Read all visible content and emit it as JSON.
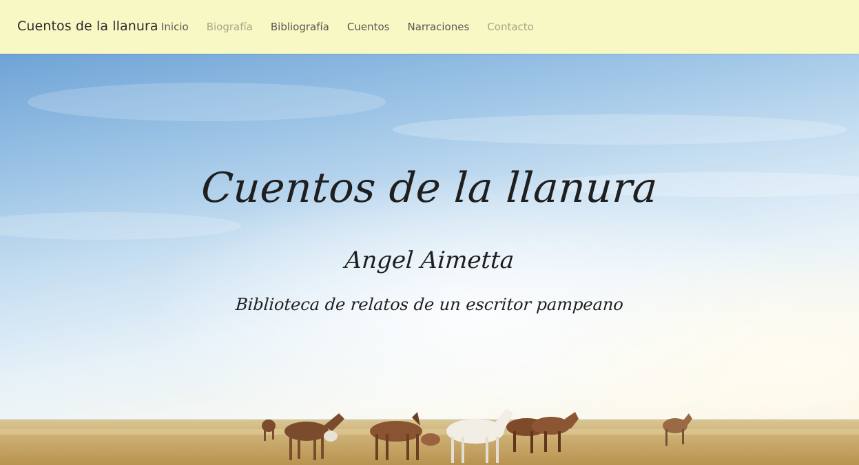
{
  "navbar": {
    "brand": "Cuentos de la llanura",
    "items": [
      {
        "label": "Inicio",
        "state": "normal"
      },
      {
        "label": "Biografía",
        "state": "muted"
      },
      {
        "label": "Bibliografía",
        "state": "normal"
      },
      {
        "label": "Cuentos",
        "state": "normal"
      },
      {
        "label": "Narraciones",
        "state": "normal"
      },
      {
        "label": "Contacto",
        "state": "muted"
      }
    ]
  },
  "hero": {
    "title": "Cuentos de la llanura",
    "author": "Angel Aimetta",
    "subtitle": "Biblioteca de relatos de un escritor pampeano",
    "background_image": "horses-on-pampa-grassland"
  },
  "colors": {
    "navbar_bg": "#f8f8c4",
    "nav_text": "#555555",
    "nav_muted": "#a5a68a",
    "hero_text": "#1f1f1f"
  }
}
